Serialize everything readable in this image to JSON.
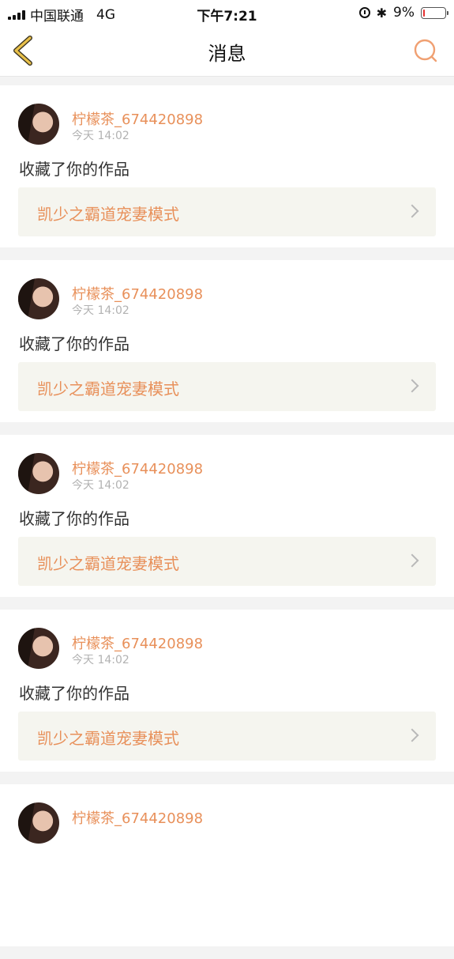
{
  "status_bar": {
    "carrier": "中国联通",
    "network": "4G",
    "time": "下午7:21",
    "battery_percent": "9%",
    "battery_level": 0.09,
    "icons": [
      "signal-icon",
      "alarm-icon",
      "bluetooth-icon",
      "battery-icon"
    ]
  },
  "nav": {
    "title": "消息",
    "back_icon": "chevron-left-icon",
    "search_icon": "search-icon",
    "accent": "#e8b24a"
  },
  "colors": {
    "username": "#e8905a",
    "timestamp": "#b2b2b2",
    "work_bg": "#f5f5ef"
  },
  "messages": [
    {
      "username": "柠檬茶_674420898",
      "time": "今天 14:02",
      "action": "收藏了你的作品",
      "work_title": "凯少之霸道宠妻模式"
    },
    {
      "username": "柠檬茶_674420898",
      "time": "今天 14:02",
      "action": "收藏了你的作品",
      "work_title": "凯少之霸道宠妻模式"
    },
    {
      "username": "柠檬茶_674420898",
      "time": "今天 14:02",
      "action": "收藏了你的作品",
      "work_title": "凯少之霸道宠妻模式"
    },
    {
      "username": "柠檬茶_674420898",
      "time": "今天 14:02",
      "action": "收藏了你的作品",
      "work_title": "凯少之霸道宠妻模式"
    },
    {
      "username": "柠檬茶_674420898",
      "time": "",
      "action": "",
      "work_title": ""
    }
  ]
}
